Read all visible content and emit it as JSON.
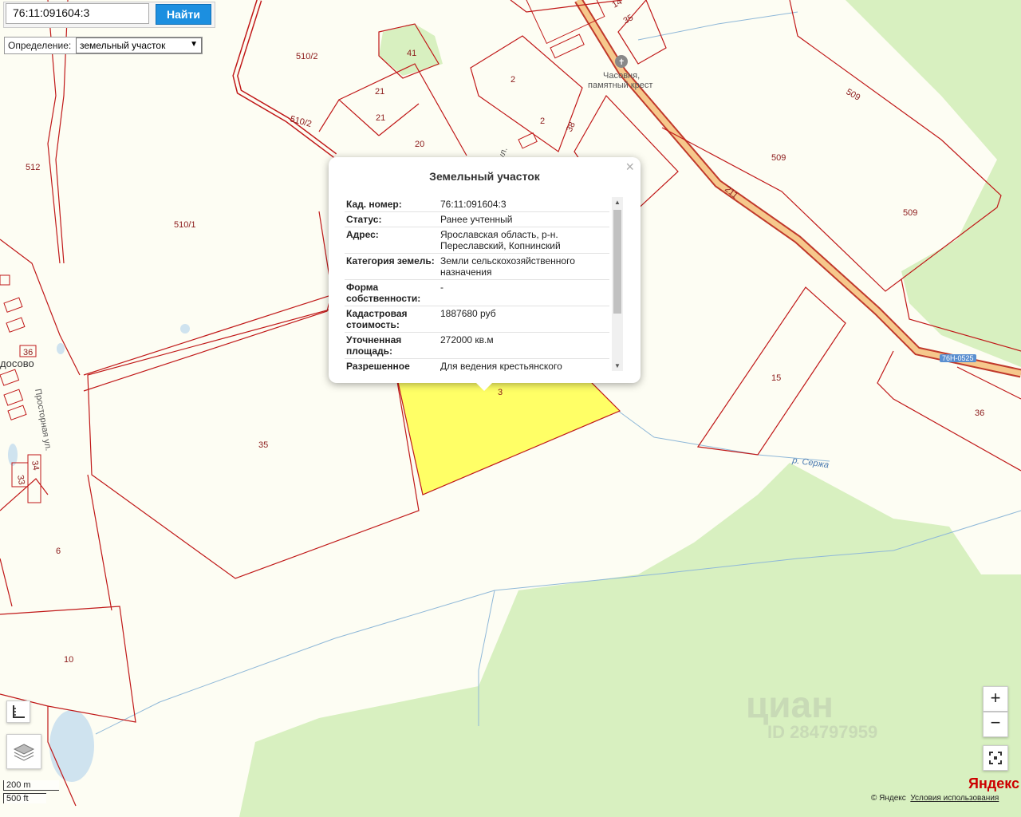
{
  "search": {
    "value": "76:11:091604:3",
    "button": "Найти"
  },
  "definition": {
    "label": "Определение:",
    "selected": "земельный участок"
  },
  "map_labels": {
    "l510_2a": "510/2",
    "l510_2b": "510/2",
    "l510_1": "510/1",
    "l512": "512",
    "l510_1top": "510/1",
    "l41": "41",
    "l21a": "21",
    "l21b": "21",
    "l20": "20",
    "l2a": "2",
    "l2b": "2",
    "l38": "38",
    "l35top": "35",
    "l14": "14",
    "chapel": "Часовня,",
    "chapel2": "памятный крест",
    "l509a": "509",
    "l509b": "509",
    "l509c": "509",
    "l211": "211",
    "road_tag": "76Н-0525",
    "l15": "15",
    "l36r": "36",
    "river": "р. Сержа",
    "l3": "3",
    "l35": "35",
    "l6": "6",
    "l10": "10",
    "l36": "36",
    "l34": "34",
    "l33": "33",
    "village": "досово",
    "street": "Просторная ул.",
    "street2": "ул."
  },
  "popup": {
    "title": "Земельный участок",
    "close": "×",
    "rows": [
      {
        "k": "Кад. номер:",
        "v": "76:11:091604:3"
      },
      {
        "k": "Статус:",
        "v": "Ранее учтенный"
      },
      {
        "k": "Адрес:",
        "v": "Ярославская область, р-н. Переславский, Копнинский"
      },
      {
        "k": "Категория земель:",
        "v": "Земли сельскохозяйственного назначения"
      },
      {
        "k": "Форма собственности:",
        "v": "-"
      },
      {
        "k": "Кадастровая стоимость:",
        "v": "1887680 руб"
      },
      {
        "k": "Уточненная площадь:",
        "v": "272000 кв.м"
      },
      {
        "k": "Разрешенное",
        "v": "Для ведения крестьянского"
      }
    ]
  },
  "controls": {
    "zoom_in": "+",
    "zoom_out": "−"
  },
  "scale": {
    "metric": "200 m",
    "imperial": "500 ft"
  },
  "attribution": {
    "logo": "Яндекс",
    "copyright": "© Яндекс",
    "terms": "Условия использования"
  },
  "watermark": {
    "brand": "циан",
    "id": "ID 284797959"
  },
  "colors": {
    "parcel_border": "#c01818",
    "highlight": "#ffff66",
    "forest": "#d8f0c0",
    "road": "#f6c88c",
    "button": "#1c8fe0"
  }
}
